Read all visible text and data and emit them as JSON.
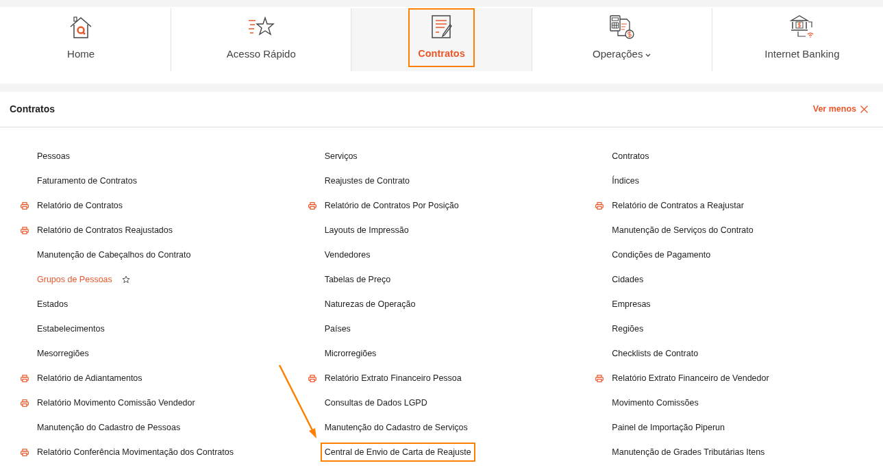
{
  "nav": [
    {
      "label": "Home",
      "kind": "home",
      "selected": false,
      "highlighted": false,
      "dropdown": false
    },
    {
      "label": "Acesso Rápido",
      "kind": "star",
      "selected": false,
      "highlighted": false,
      "dropdown": false
    },
    {
      "label": "Contratos",
      "kind": "contract",
      "selected": true,
      "highlighted": true,
      "dropdown": false
    },
    {
      "label": "Operações",
      "kind": "operations",
      "selected": false,
      "highlighted": false,
      "dropdown": true
    },
    {
      "label": "Internet Banking",
      "kind": "bank",
      "selected": false,
      "highlighted": false,
      "dropdown": false
    }
  ],
  "panel": {
    "title": "Contratos",
    "toggle_label": "Ver menos"
  },
  "columns": [
    [
      {
        "label": "Pessoas",
        "kind": "page",
        "highlighted": false
      },
      {
        "label": "Faturamento de Contratos",
        "kind": "page",
        "highlighted": false
      },
      {
        "label": "Relatório de Contratos",
        "kind": "report",
        "highlighted": false
      },
      {
        "label": "Relatório de Contratos Reajustados",
        "kind": "report",
        "highlighted": false
      },
      {
        "label": "Manutenção de Cabeçalhos do Contrato",
        "kind": "page",
        "highlighted": false
      },
      {
        "label": "Grupos de Pessoas",
        "kind": "hovered",
        "highlighted": false
      },
      {
        "label": "Estados",
        "kind": "page",
        "highlighted": false
      },
      {
        "label": "Estabelecimentos",
        "kind": "page",
        "highlighted": false
      },
      {
        "label": "Mesorregiões",
        "kind": "page",
        "highlighted": false
      },
      {
        "label": "Relatório de Adiantamentos",
        "kind": "report",
        "highlighted": false
      },
      {
        "label": "Relatório Movimento Comissão Vendedor",
        "kind": "report",
        "highlighted": false
      },
      {
        "label": "Manutenção do Cadastro de Pessoas",
        "kind": "page",
        "highlighted": false
      },
      {
        "label": "Relatório Conferência Movimentação dos Contratos",
        "kind": "report",
        "highlighted": false
      }
    ],
    [
      {
        "label": "Serviços",
        "kind": "page",
        "highlighted": false
      },
      {
        "label": "Reajustes de Contrato",
        "kind": "page",
        "highlighted": false
      },
      {
        "label": "Relatório de Contratos Por Posição",
        "kind": "report",
        "highlighted": false
      },
      {
        "label": "Layouts de Impressão",
        "kind": "page",
        "highlighted": false
      },
      {
        "label": "Vendedores",
        "kind": "page",
        "highlighted": false
      },
      {
        "label": "Tabelas de Preço",
        "kind": "page",
        "highlighted": false
      },
      {
        "label": "Naturezas de Operação",
        "kind": "page",
        "highlighted": false
      },
      {
        "label": "Países",
        "kind": "page",
        "highlighted": false
      },
      {
        "label": "Microrregiões",
        "kind": "page",
        "highlighted": false
      },
      {
        "label": "Relatório Extrato Financeiro Pessoa",
        "kind": "report",
        "highlighted": false
      },
      {
        "label": "Consultas de Dados LGPD",
        "kind": "page",
        "highlighted": false
      },
      {
        "label": "Manutenção do Cadastro de Serviços",
        "kind": "page",
        "highlighted": false
      },
      {
        "label": "Central de Envio de Carta de Reajuste",
        "kind": "page",
        "highlighted": true
      }
    ],
    [
      {
        "label": "Contratos",
        "kind": "page",
        "highlighted": false
      },
      {
        "label": "Índices",
        "kind": "page",
        "highlighted": false
      },
      {
        "label": "Relatório de Contratos a Reajustar",
        "kind": "report",
        "highlighted": false
      },
      {
        "label": "Manutenção de Serviços do Contrato",
        "kind": "page",
        "highlighted": false
      },
      {
        "label": "Condições de Pagamento",
        "kind": "page",
        "highlighted": false
      },
      {
        "label": "Cidades",
        "kind": "page",
        "highlighted": false
      },
      {
        "label": "Empresas",
        "kind": "page",
        "highlighted": false
      },
      {
        "label": "Regiões",
        "kind": "page",
        "highlighted": false
      },
      {
        "label": "Checklists de Contrato",
        "kind": "page",
        "highlighted": false
      },
      {
        "label": "Relatório Extrato Financeiro de Vendedor",
        "kind": "report",
        "highlighted": false
      },
      {
        "label": "Movimento Comissões",
        "kind": "page",
        "highlighted": false
      },
      {
        "label": "Painel de Importação Piperun",
        "kind": "page",
        "highlighted": false
      },
      {
        "label": "Manutenção de Grades Tributárias Itens",
        "kind": "page",
        "highlighted": false
      }
    ]
  ],
  "annotation_arrow": true
}
